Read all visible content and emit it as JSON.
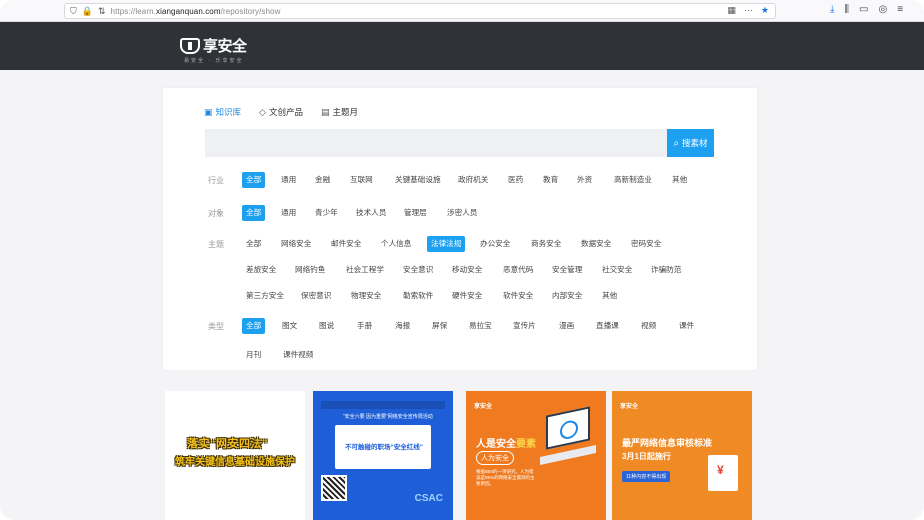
{
  "browser": {
    "url_prefix": "https://learn.",
    "url_domain": "xianganquan.com",
    "url_path": "/repository/show",
    "icons": [
      "shield-icon",
      "lock-icon",
      "extensions-icon",
      "reader-icon",
      "more-icon",
      "star-icon",
      "download-icon",
      "library-icon",
      "sidebar-icon",
      "account-icon",
      "menu-icon"
    ]
  },
  "header": {
    "logo_text": "享安全",
    "logo_sub": "易安全 · 乐享安全"
  },
  "tabs": [
    {
      "label": "知识库",
      "icon": "book-icon",
      "active": true
    },
    {
      "label": "文创产品",
      "icon": "tag-icon",
      "active": false
    },
    {
      "label": "主题月",
      "icon": "calendar-icon",
      "active": false
    }
  ],
  "search": {
    "value": "",
    "placeholder": "",
    "button_label": "搜素材"
  },
  "filters": {
    "industry": {
      "label": "行业",
      "options": [
        "全部",
        "通用",
        "金融",
        "互联网",
        "关键基础设施",
        "政府机关",
        "医药",
        "教育",
        "外资",
        "高新制造业",
        "其他"
      ],
      "selected": 0
    },
    "audience": {
      "label": "对象",
      "options": [
        "全部",
        "通用",
        "青少年",
        "技术人员",
        "管理层",
        "涉密人员"
      ],
      "selected": 0
    },
    "topic": {
      "label": "主题",
      "rows": [
        [
          "全部",
          "网络安全",
          "邮件安全",
          "个人信息",
          "法律法规",
          "办公安全",
          "商务安全",
          "数据安全",
          "密码安全"
        ],
        [
          "差旅安全",
          "网络钓鱼",
          "社会工程学",
          "安全意识",
          "移动安全",
          "恶意代码",
          "安全管理",
          "社交安全",
          "诈骗防范"
        ],
        [
          "第三方安全",
          "保密意识",
          "物理安全",
          "勒索软件",
          "硬件安全",
          "软件安全",
          "内部安全",
          "其他"
        ]
      ],
      "selected": "法律法规"
    },
    "type": {
      "label": "类型",
      "rows": [
        [
          "全部",
          "图文",
          "图说",
          "手册",
          "海报",
          "屏保",
          "易拉宝",
          "宣传片",
          "漫画",
          "直播课",
          "视频",
          "课件"
        ],
        [
          "月刊",
          "课件视频"
        ]
      ],
      "selected": "全部"
    }
  },
  "cards": [
    {
      "line1": "落实“网安四法”",
      "line2": "筑牢关键信息基础设施保护"
    },
    {
      "title": "“安全六要 因为重要”网络安全宣传周活动",
      "box_text": "不可触碰的职场“安全红线”",
      "badge": "CSAC"
    },
    {
      "logo": "享安全",
      "big_pre": "人",
      "big_mid": "是安全",
      "big_accent": "要素",
      "sub": "人为安全",
      "body": "根据IBM的一项研究，人为错误是95%的网络安全漏洞的主要原因。"
    },
    {
      "logo": "享安全",
      "h1": "最严网络信息审核标准",
      "h2": "3月1日起施行",
      "pill": "11种内容不得出现"
    }
  ]
}
